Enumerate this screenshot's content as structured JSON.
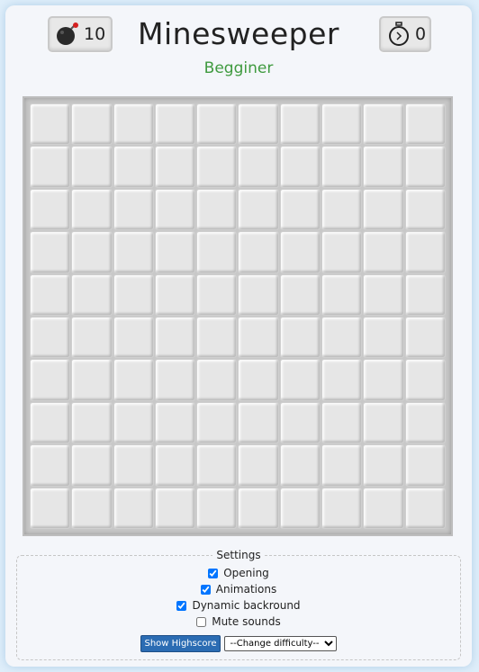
{
  "header": {
    "title": "Minesweeper",
    "difficulty": "Begginer",
    "mines_count": "10",
    "timer": "0"
  },
  "icons": {
    "mine": "bomb-icon",
    "timer": "stopwatch-icon"
  },
  "board": {
    "rows": 10,
    "cols": 10
  },
  "settings": {
    "legend": "Settings",
    "options": [
      {
        "label": "Opening",
        "checked": true
      },
      {
        "label": "Animations",
        "checked": true
      },
      {
        "label": "Dynamic backround",
        "checked": true
      },
      {
        "label": "Mute sounds",
        "checked": false
      }
    ],
    "highscore_button": "Show Highscore",
    "difficulty_select": "--Change difficulty--"
  },
  "colors": {
    "difficulty_text": "#3f9a3f",
    "button": "#2b6cb3"
  }
}
